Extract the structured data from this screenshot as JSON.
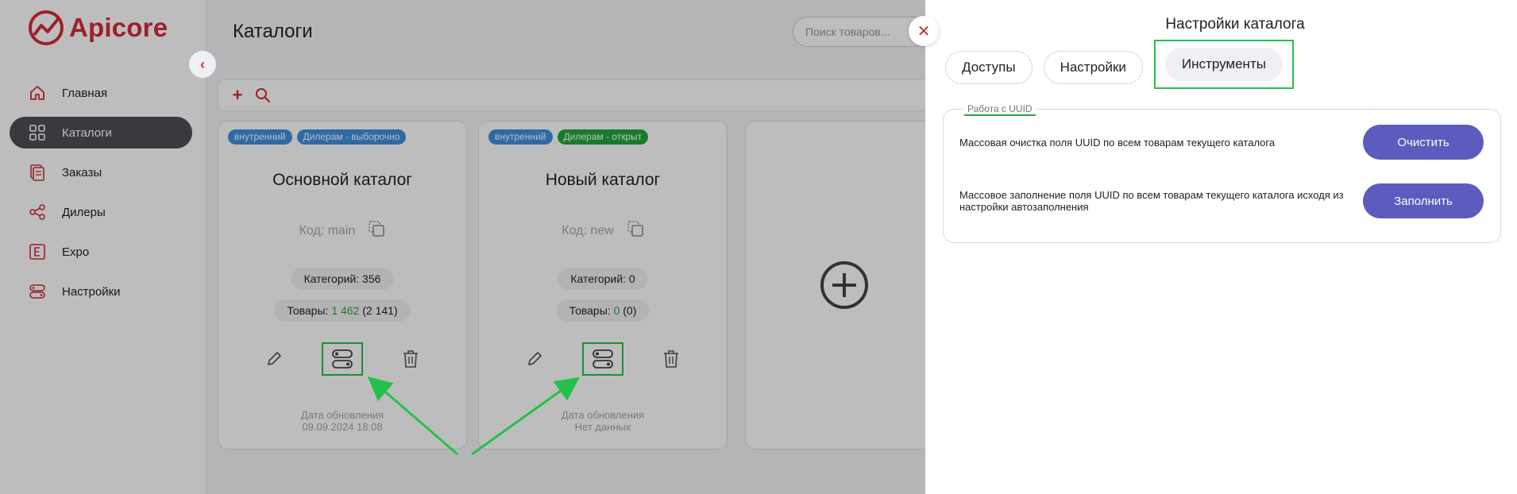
{
  "app": {
    "logo_text": "Apicore",
    "brand_color": "#d42a3a"
  },
  "sidebar": {
    "items": [
      {
        "label": "Главная",
        "icon": "home-icon",
        "active": false
      },
      {
        "label": "Каталоги",
        "icon": "grid-icon",
        "active": true
      },
      {
        "label": "Заказы",
        "icon": "orders-icon",
        "active": false
      },
      {
        "label": "Дилеры",
        "icon": "share-icon",
        "active": false
      },
      {
        "label": "Expo",
        "icon": "expo-icon",
        "active": false
      },
      {
        "label": "Настройки",
        "icon": "settings-icon",
        "active": false
      }
    ]
  },
  "header": {
    "title": "Каталоги",
    "search_placeholder": "Поиск товаров..."
  },
  "cards": [
    {
      "badges": [
        {
          "label": "внутренний",
          "color": "blue"
        },
        {
          "label": "Дилерам - выборочно",
          "color": "blue"
        }
      ],
      "title": "Основной каталог",
      "code": "Код: main",
      "categories": "Категорий: 356",
      "products_label": "Товары: ",
      "products_green": "1 462",
      "products_total": " (2 141)",
      "date_label": "Дата обновления",
      "date_value": "09.09.2024 18:08"
    },
    {
      "badges": [
        {
          "label": "внутренний",
          "color": "blue"
        },
        {
          "label": "Дилерам - открыт",
          "color": "green"
        }
      ],
      "title": "Новый каталог",
      "code": "Код: new",
      "categories": "Категорий: 0",
      "products_label": "Товары: ",
      "products_green": "0",
      "products_total": " (0)",
      "date_label": "Дата обновления",
      "date_value": "Нет данных"
    }
  ],
  "drawer": {
    "title": "Настройки каталога",
    "tabs": [
      "Доступы",
      "Настройки",
      "Инструменты"
    ],
    "active_tab": "Инструменты",
    "section_legend": "Работа с UUID",
    "rows": [
      {
        "text": "Массовая очистка поля UUID по всем товарам текущего каталога",
        "button": "Очистить"
      },
      {
        "text": "Массовое заполнение поля UUID по всем товарам текущего каталога исходя из настройки автозаполнения",
        "button": "Заполнить"
      }
    ],
    "button_color": "#5e5bbf",
    "highlight_color": "#22c24a"
  }
}
